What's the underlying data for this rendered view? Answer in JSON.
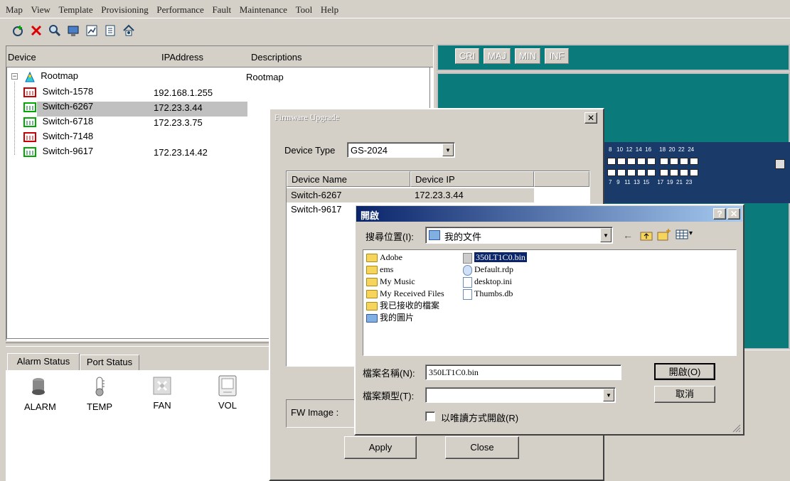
{
  "menu": [
    "Map",
    "View",
    "Template",
    "Provisioning",
    "Performance",
    "Fault",
    "Maintenance",
    "Tool",
    "Help"
  ],
  "tree": {
    "columns": [
      "Device",
      "IPAddress",
      "Descriptions"
    ],
    "root": {
      "label": "Rootmap",
      "description": "Rootmap"
    },
    "devices": [
      {
        "name": "Switch-1578",
        "ip": "192.168.1.255"
      },
      {
        "name": "Switch-6267",
        "ip": "172.23.3.44"
      },
      {
        "name": "Switch-6718",
        "ip": "172.23.3.75"
      },
      {
        "name": "Switch-7148",
        "ip": ""
      },
      {
        "name": "Switch-9617",
        "ip": "172.23.14.42"
      }
    ]
  },
  "status_tabs": [
    "Alarm Status",
    "Port Status"
  ],
  "status_icons": [
    "ALARM",
    "TEMP",
    "FAN",
    "VOL"
  ],
  "severity": [
    "CRI",
    "MAJ",
    "MIN",
    "INF"
  ],
  "switch_labels": {
    "top": "8   10  12  14  16     18  20  22  24",
    "bottom": "7   9   11  13  15     17  19  21  23"
  },
  "firmware": {
    "title": "Firmware Upgrade",
    "device_type_label": "Device Type",
    "device_type_value": "GS-2024",
    "columns": [
      "Device Name",
      "Device IP"
    ],
    "rows": [
      {
        "name": "Switch-6267",
        "ip": "172.23.3.44"
      },
      {
        "name": "Switch-9617",
        "ip": ""
      }
    ],
    "fw_image_label": "FW Image :",
    "apply": "Apply",
    "close": "Close"
  },
  "open_dialog": {
    "title": "開啟",
    "look_in_label": "搜尋位置(I):",
    "look_in_value": "我的文件",
    "left_items": [
      "Adobe",
      "ems",
      "My Music",
      "My Received Files",
      "我已接收的檔案",
      "我的圖片"
    ],
    "right_items": [
      "350LT1C0.bin",
      "Default.rdp",
      "desktop.ini",
      "Thumbs.db"
    ],
    "filename_label": "檔案名稱(N):",
    "filename_value": "350LT1C0.bin",
    "filetype_label": "檔案類型(T):",
    "filetype_value": "",
    "readonly_label": "以唯讀方式開啟(R)",
    "open_button": "開啟(O)",
    "cancel_button": "取消",
    "help_glyph": "?",
    "close_glyph": "✕"
  },
  "colors": {
    "teal": "#0a7a7a",
    "title_dark": "#0a246a",
    "title_light": "#a6caf0",
    "selection": "#0a246a"
  }
}
